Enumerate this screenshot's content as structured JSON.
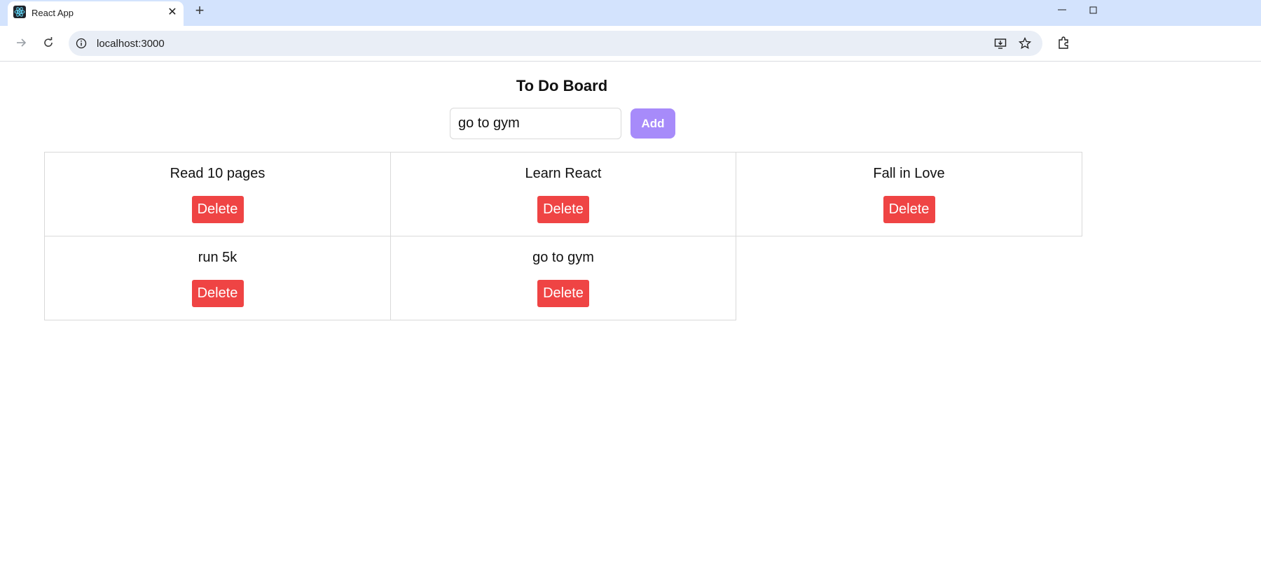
{
  "browser": {
    "tab_title": "React App",
    "url": "localhost:3000",
    "icons": [
      "react-logo-icon",
      "close-icon",
      "plus-icon",
      "minimize-icon",
      "restore-icon",
      "forward-icon",
      "reload-icon",
      "info-icon",
      "install-app-icon",
      "star-icon",
      "extensions-icon"
    ]
  },
  "page": {
    "title": "To Do Board",
    "input_value": "go to gym",
    "add_label": "Add"
  },
  "todos": [
    {
      "text": "Read 10 pages",
      "delete_label": "Delete"
    },
    {
      "text": "Learn React",
      "delete_label": "Delete"
    },
    {
      "text": "Fall in Love",
      "delete_label": "Delete"
    },
    {
      "text": "run 5k",
      "delete_label": "Delete"
    },
    {
      "text": "go to gym",
      "delete_label": "Delete"
    }
  ],
  "colors": {
    "add_button": "#a78bfa",
    "delete_button": "#ef4444",
    "tabbar": "#d3e3fd"
  }
}
